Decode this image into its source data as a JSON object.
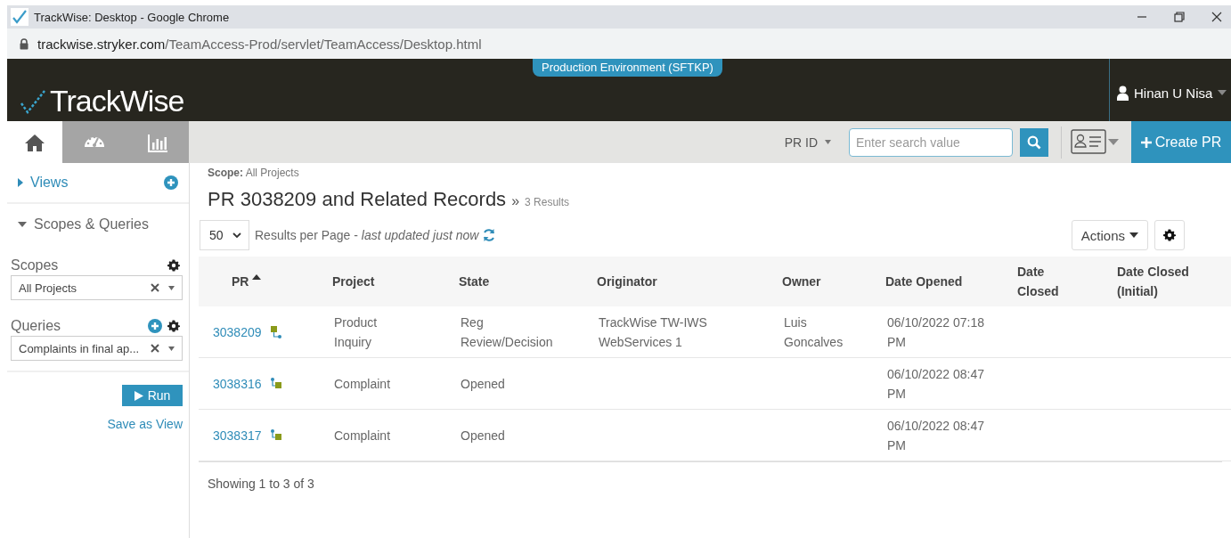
{
  "window": {
    "title": "TrackWise: Desktop - Google Chrome"
  },
  "address_bar": {
    "domain": "trackwise.stryker.com",
    "path": "/TeamAccess-Prod/servlet/TeamAccess/Desktop.html"
  },
  "header": {
    "logo": "TrackWise",
    "environment": "Production Environment (SFTKP)",
    "user": "Hinan U Nisa"
  },
  "nav_tabs": [
    {
      "kind": "home",
      "selected": true
    },
    {
      "kind": "dashboard",
      "selected": false
    },
    {
      "kind": "chart",
      "selected": false
    }
  ],
  "search": {
    "field": "PR ID",
    "placeholder": "Enter search value"
  },
  "create_button": "Create PR",
  "sidebar": {
    "sections": [
      {
        "label": "Views",
        "expanded": false
      },
      {
        "label": "Scopes & Queries",
        "expanded": true
      }
    ],
    "scopes": {
      "label": "Scopes",
      "value": "All Projects"
    },
    "queries": {
      "label": "Queries",
      "value": "Complaints in final ap..."
    },
    "run_button": "Run",
    "save_link": "Save as View"
  },
  "main": {
    "scope_label": "Scope:",
    "scope_value": "All Projects",
    "title": "PR 3038209 and Related Records",
    "title_mark": "»",
    "result_count": "3 Results",
    "page_size": "50",
    "per_page_text": "Results per Page - *last updated just now*",
    "actions_button": "Actions"
  },
  "table": {
    "columns": [
      {
        "label": "PR",
        "sorted": true
      },
      {
        "label": "Project",
        "sorted": false
      },
      {
        "label": "State",
        "sorted": false
      },
      {
        "label": "Originator",
        "sorted": false
      },
      {
        "label": "Owner",
        "sorted": false
      },
      {
        "label": "Date Opened",
        "sorted": false
      },
      {
        "label": "Date Closed",
        "sorted": false
      },
      {
        "label": "Date Closed (Initial)",
        "sorted": false
      }
    ],
    "rows": [
      {
        "pr": "3038209",
        "kind": "parent",
        "project": "Product Inquiry",
        "state": "Reg Review/Decision",
        "originator": "TrackWise TW-IWS WebServices 1",
        "owner": "Luis Goncalves",
        "date_opened": "06/10/2022 07:18 PM"
      },
      {
        "pr": "3038316",
        "kind": "child",
        "project": "Complaint",
        "state": "Opened",
        "date_opened": "06/10/2022 08:47 PM"
      },
      {
        "pr": "3038317",
        "kind": "child",
        "project": "Complaint",
        "state": "Opened",
        "date_opened": "06/10/2022 08:47 PM"
      }
    ]
  },
  "footer": "Showing 1 to 3 of 3"
}
